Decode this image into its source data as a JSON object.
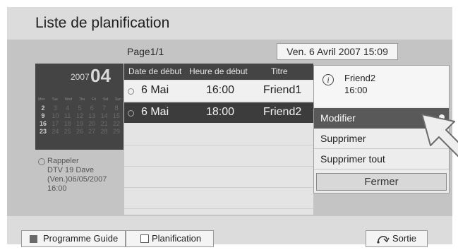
{
  "header": {
    "title": "Liste de planification"
  },
  "page_indicator": "Page1/1",
  "current_datetime": "Ven. 6 Avril 2007 15:09",
  "calendar": {
    "year": "2007",
    "month": "04",
    "weekdays": [
      "Mon",
      "Tue",
      "Wed",
      "Thu",
      "Fri",
      "Sat",
      "Sun"
    ],
    "weeks": [
      [
        "2",
        "3",
        "4",
        "5",
        "6",
        "7",
        "8"
      ],
      [
        "9",
        "10",
        "11",
        "12",
        "13",
        "14",
        "15"
      ],
      [
        "16",
        "17",
        "18",
        "19",
        "20",
        "21",
        "22"
      ],
      [
        "23",
        "24",
        "25",
        "26",
        "27",
        "28",
        "29"
      ]
    ]
  },
  "reminder": {
    "icon": "clock-icon",
    "text": "Rappeler\nDTV 19 Dave\n(Ven.)06/05/2007\n16:00"
  },
  "schedule_table": {
    "columns": [
      "Date de début",
      "Heure de début",
      "Titre"
    ],
    "rows": [
      {
        "date": "6 Mai",
        "time": "16:00",
        "title": "Friend1",
        "icon": "clock-icon",
        "selected": false
      },
      {
        "date": "6 Mai",
        "time": "18:00",
        "title": "Friend2",
        "icon": "clock-icon",
        "selected": true
      }
    ]
  },
  "popup": {
    "info_icon": "info-icon",
    "program_name": "Friend2",
    "program_time": "16:00",
    "menu_items": [
      "Modifier",
      "Supprimer",
      "Supprimer tout"
    ],
    "selected_item": "Modifier",
    "close_label": "Fermer"
  },
  "footer": {
    "guide_label": "Programme Guide",
    "planning_label": "Planification",
    "exit_label": "Sortie",
    "exit_icon": "return-icon"
  },
  "colors": {
    "screen_bg": "#c4c4c4",
    "bar_bg": "#dcdcdc",
    "dark_panel": "#444444",
    "selected_row": "#3c3c3c",
    "selected_menu": "#595959"
  }
}
